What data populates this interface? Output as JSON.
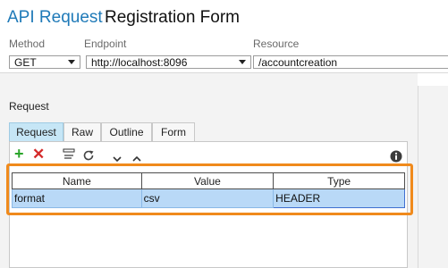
{
  "header": {
    "app": "API Request",
    "form": "Registration Form"
  },
  "fields": {
    "method_label": "Method",
    "method_value": "GET",
    "endpoint_label": "Endpoint",
    "endpoint_value": "http://localhost:8096",
    "resource_label": "Resource",
    "resource_value": "/accountcreation"
  },
  "request": {
    "section_label": "Request",
    "tabs": [
      {
        "label": "Request",
        "active": true
      },
      {
        "label": "Raw",
        "active": false
      },
      {
        "label": "Outline",
        "active": false
      },
      {
        "label": "Form",
        "active": false
      }
    ],
    "toolbar": {
      "add_icon": "plus-icon",
      "delete_icon": "delete-x-icon",
      "encode_icon": "url-encode-icon",
      "refresh_icon": "refresh-icon",
      "move_down_icon": "chevron-down-icon",
      "move_up_icon": "chevron-up-icon",
      "info_icon": "info-icon"
    },
    "grid": {
      "columns": [
        "Name",
        "Value",
        "Type"
      ],
      "rows": [
        {
          "name": "format",
          "value": "csv",
          "type": "HEADER"
        }
      ]
    }
  },
  "colors": {
    "accent": "#1f7ab8",
    "highlight": "#f08a1c",
    "selected_row": "#b9d9f7",
    "active_tab": "#c6e6f6",
    "add": "#2aa52a",
    "delete": "#d42a2a"
  }
}
